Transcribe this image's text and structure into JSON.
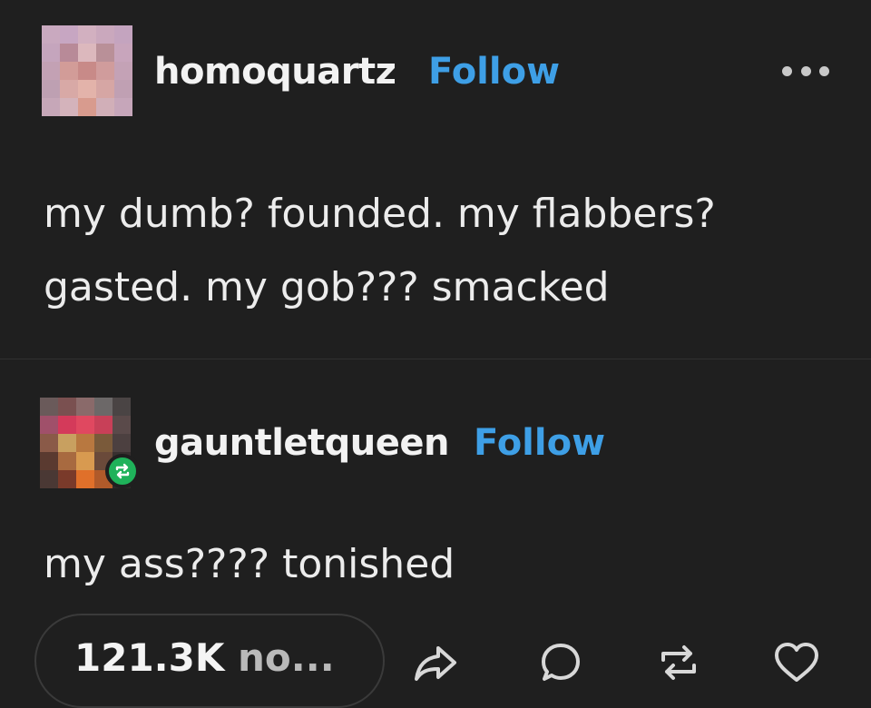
{
  "post": {
    "author": {
      "username": "homoquartz",
      "follow_label": "Follow"
    },
    "body_lines": [
      "my dumb? founded. my flabbers?",
      "gasted. my gob??? smacked"
    ],
    "more_icon": "more-horizontal-icon"
  },
  "reblog": {
    "author": {
      "username": "gauntletqueen",
      "follow_label": "Follow"
    },
    "body_lines": [
      "my ass???? tonished"
    ],
    "badge_icon": "reblog-icon"
  },
  "footer": {
    "notes_count": "121.3K",
    "notes_suffix": " no...",
    "actions": [
      "share-icon",
      "reply-icon",
      "reblog-icon",
      "like-icon"
    ]
  },
  "colors": {
    "background": "#1f1f1f",
    "text": "#ececec",
    "follow": "#3e9fe6",
    "reblog_badge": "#1fb25a",
    "icon": "#d8d8d8"
  }
}
